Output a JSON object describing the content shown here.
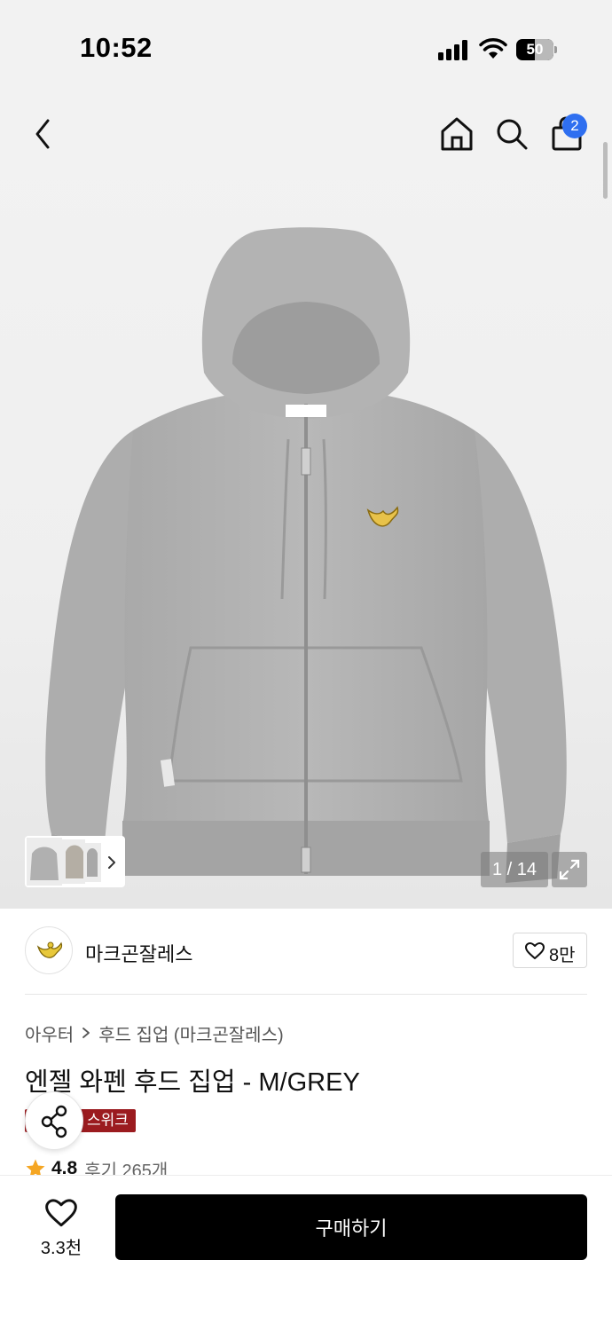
{
  "status_bar": {
    "time": "10:52",
    "battery_level": "50",
    "battery_fraction": 0.5
  },
  "header": {
    "cart_count": "2"
  },
  "gallery": {
    "counter": "1 / 14"
  },
  "brand": {
    "name": "마크곤잘레스",
    "likes": "8만"
  },
  "breadcrumb": {
    "category": "아우터",
    "subcategory": "후드 집업 (마크곤잘레스)"
  },
  "product": {
    "title": "엔젤 와펜 후드 집업 - M/GREY",
    "promo_badge": "스위크",
    "rating": "4.8",
    "review_count": "후기 265개"
  },
  "bottom_bar": {
    "like_count": "3.3천",
    "buy_label": "구매하기"
  },
  "colors": {
    "accent": "#2f6ff0",
    "promo": "#9b1b1f",
    "rating_star": "#f5a623",
    "buy_button": "#000000"
  }
}
